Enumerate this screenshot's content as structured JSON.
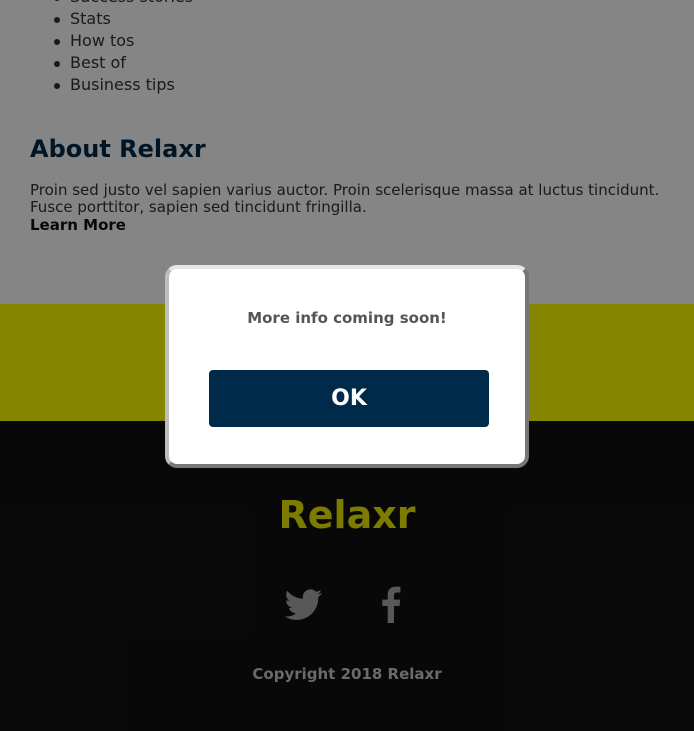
{
  "categories": [
    "Success stories",
    "Stats",
    "How tos",
    "Best of",
    "Business tips"
  ],
  "about": {
    "title": "About Relaxr",
    "text": "Proin sed justo vel sapien varius auctor. Proin scelerisque massa at luctus tincidunt. Fusce porttitor, sapien sed tincidunt fringilla.",
    "link_label": "Learn More"
  },
  "footer": {
    "brand": "Relaxr",
    "copyright": "Copyright 2018 Relaxr",
    "social": [
      {
        "name": "twitter",
        "icon": "twitter-icon"
      },
      {
        "name": "facebook",
        "icon": "facebook-icon"
      }
    ]
  },
  "modal": {
    "message": "More info coming soon!",
    "button_label": "OK"
  },
  "colors": {
    "navy": "#002a4a",
    "yellow": "#ffff00",
    "footer_bg": "#111111",
    "brand_yellow": "#eeee00"
  }
}
